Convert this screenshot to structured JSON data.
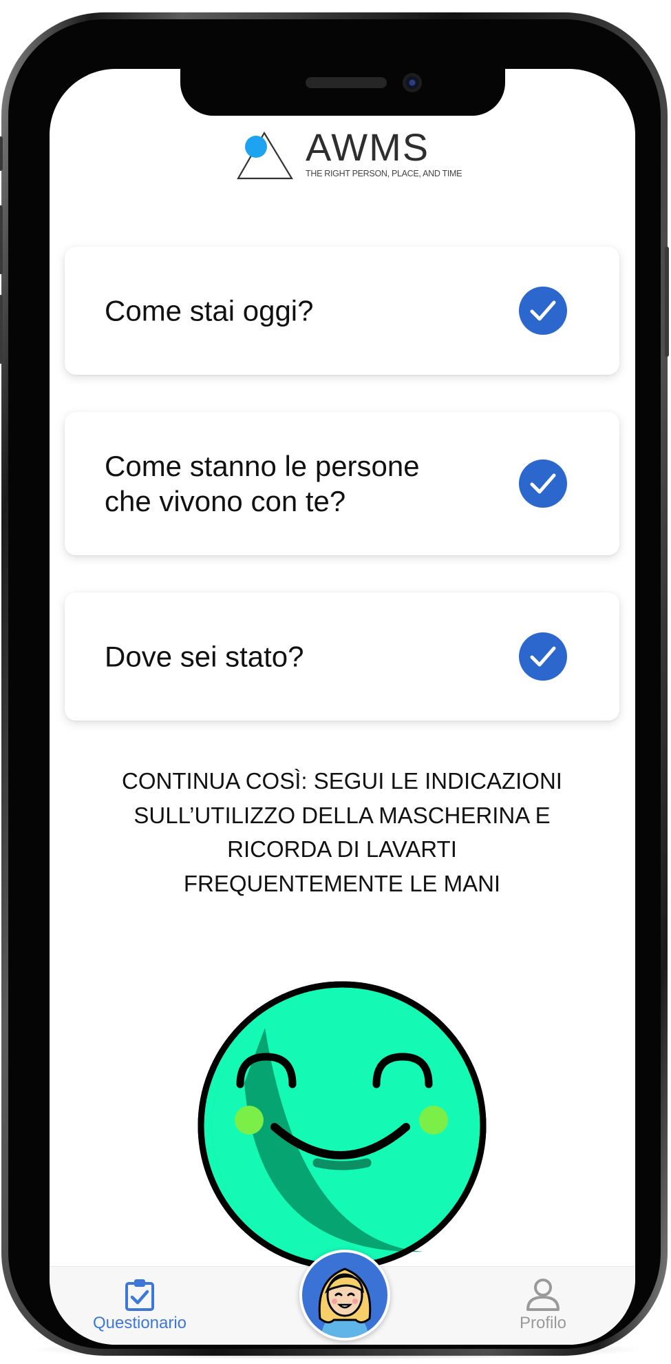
{
  "logo": {
    "name": "AWMS",
    "tagline": "THE RIGHT PERSON, PLACE, AND TIME",
    "dot_color": "#1ea3f0"
  },
  "questions": [
    {
      "label": "Come stai oggi?",
      "status": "completed"
    },
    {
      "label": "Come stanno le persone che vivono con te?",
      "status": "completed"
    },
    {
      "label": "Dove sei stato?",
      "status": "completed"
    }
  ],
  "message": "CONTINUA COSÌ: SEGUI LE INDICAZIONI SULL’UTILIZZO DELLA MASCHERINA E RICORDA DI LAVARTI FREQUENTEMENTE LE MANI",
  "mood_icon": "happy-face-icon",
  "nav": {
    "questionnaire_label": "Questionario",
    "profile_label": "Profilo",
    "active": "Questionario"
  },
  "colors": {
    "accent": "#2b67cc",
    "nav_active": "#3d78d8",
    "nav_inactive": "#9a9a9a",
    "smiley": "#14f9b4"
  }
}
